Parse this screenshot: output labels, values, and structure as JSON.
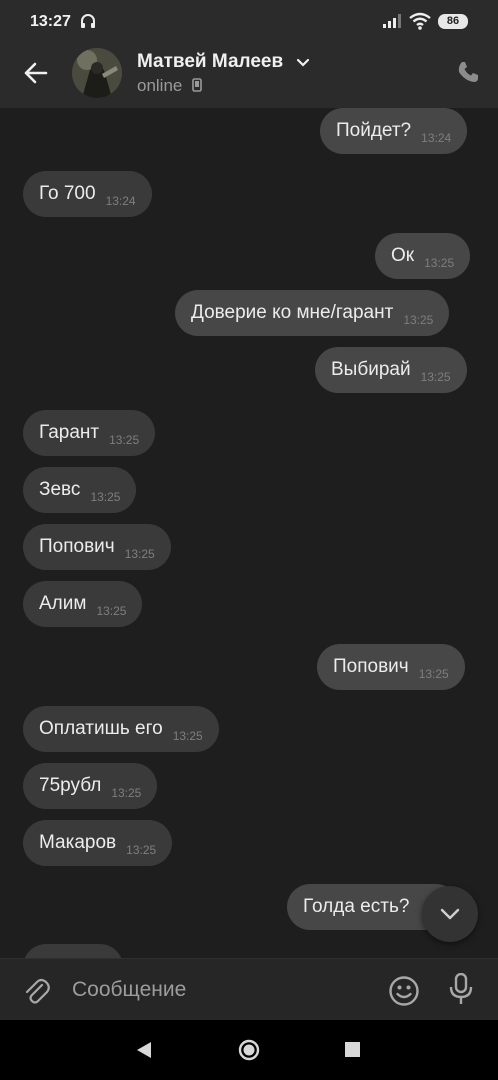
{
  "status_bar": {
    "time": "13:27",
    "battery": "86"
  },
  "header": {
    "contact_name": "Матвей Малеев",
    "status": "online"
  },
  "messages": [
    {
      "text": "Пойдет?",
      "time": "13:24",
      "direction": "out"
    },
    {
      "text": "Го 700",
      "time": "13:24",
      "direction": "in"
    },
    {
      "text": "Ок",
      "time": "13:25",
      "direction": "out"
    },
    {
      "text": "Доверие ко мне/гарант",
      "time": "13:25",
      "direction": "out"
    },
    {
      "text": "Выбирай",
      "time": "13:25",
      "direction": "out"
    },
    {
      "text": "Гарант",
      "time": "13:25",
      "direction": "in"
    },
    {
      "text": "Зевс",
      "time": "13:25",
      "direction": "in"
    },
    {
      "text": "Попович",
      "time": "13:25",
      "direction": "in"
    },
    {
      "text": "Алим",
      "time": "13:25",
      "direction": "in"
    },
    {
      "text": "Попович",
      "time": "13:25",
      "direction": "out"
    },
    {
      "text": "Оплатишь его",
      "time": "13:25",
      "direction": "in"
    },
    {
      "text": "75рубл",
      "time": "13:25",
      "direction": "in"
    },
    {
      "text": "Макаров",
      "time": "13:25",
      "direction": "in"
    },
    {
      "text": "Голда есть?",
      "time": "",
      "direction": "out"
    }
  ],
  "composer": {
    "placeholder": "Сообщение"
  },
  "icons": {
    "back": "arrow-left-icon",
    "call": "phone-icon",
    "attach": "paperclip-icon",
    "emoji": "smiley-icon",
    "mic": "microphone-icon",
    "scroll_down": "chevron-down-icon"
  },
  "colors": {
    "background": "#1e1e1e",
    "bar": "#2b2b2b",
    "bubble_in": "#3a3a3a",
    "bubble_out": "#474747"
  }
}
